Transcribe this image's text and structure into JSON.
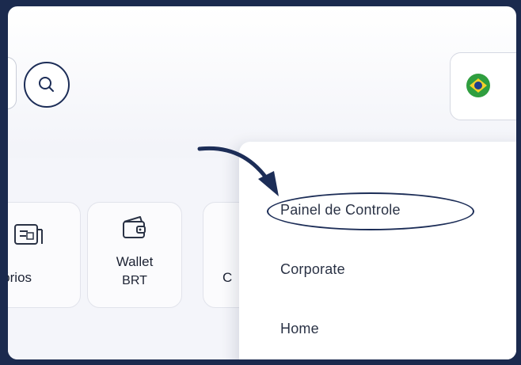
{
  "header": {
    "search_icon": "search-icon",
    "language_flag": "brazil-flag-icon"
  },
  "shortcuts": [
    {
      "label": "atórios",
      "icon": "report-icon"
    },
    {
      "label_line1": "Wallet",
      "label_line2": "BRT",
      "icon": "wallet-icon"
    },
    {
      "label": "C",
      "icon": ""
    }
  ],
  "menu": {
    "items": [
      {
        "label": "Painel de Controle",
        "highlighted": true
      },
      {
        "label": "Corporate"
      },
      {
        "label": "Home"
      }
    ]
  },
  "colors": {
    "outer_background": "#1b2a4e",
    "accent": "#1c2d57",
    "flag_green": "#2f9e3f",
    "flag_yellow": "#f3d12a",
    "flag_blue": "#1d3f8f"
  }
}
